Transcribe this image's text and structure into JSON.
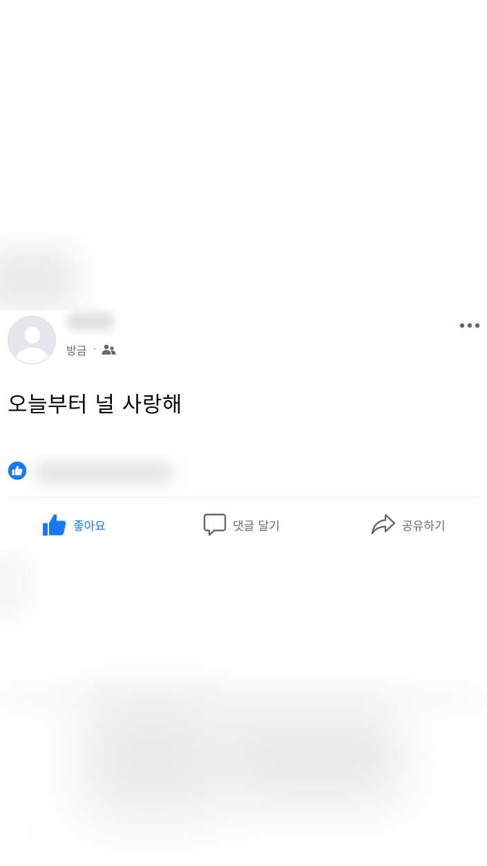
{
  "post": {
    "timestamp": "방금",
    "separator": "·",
    "privacy_icon": "friends-icon",
    "more_icon": "more-horizontal-icon",
    "text": "오늘부터 널 사랑해",
    "reaction_icon": "like-reaction-icon"
  },
  "actions": {
    "like_label": "좋아요",
    "comment_label": "댓글 달기",
    "share_label": "공유하기"
  },
  "colors": {
    "accent": "#1877f2",
    "secondary_text": "#65676b",
    "primary_text": "#050505",
    "divider": "#ebedf0"
  }
}
